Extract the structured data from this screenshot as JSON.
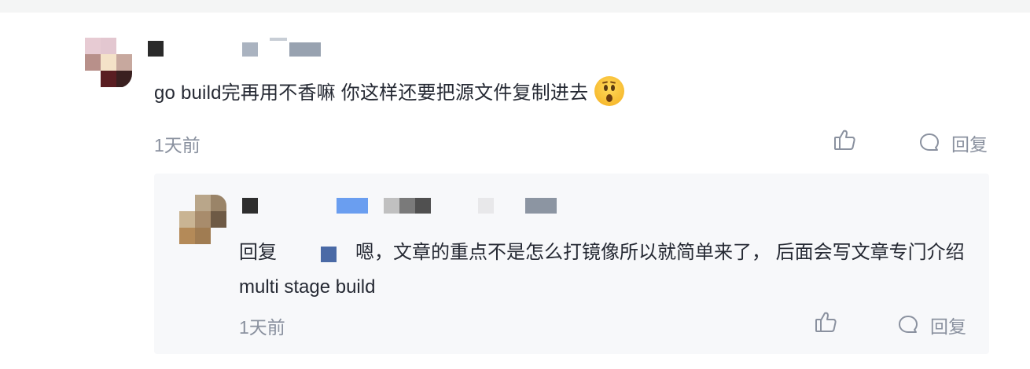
{
  "comment": {
    "text": "go build完再用不香嘛 你这样还要把源文件复制进去",
    "emoji": "hushed-face",
    "time": "1天前",
    "reply_label": "回复",
    "like_icon": "thumbs-up-icon",
    "reply_icon": "comment-bubble-icon"
  },
  "reply": {
    "prefix": "回复",
    "text": "嗯，文章的重点不是怎么打镜像所以就简单来了， 后面会写文章专门介绍multi stage build",
    "time": "1天前",
    "reply_label": "回复"
  },
  "colors": {
    "text": "#252933",
    "muted": "#8a919f",
    "reply_background": "#f7f8fa"
  }
}
